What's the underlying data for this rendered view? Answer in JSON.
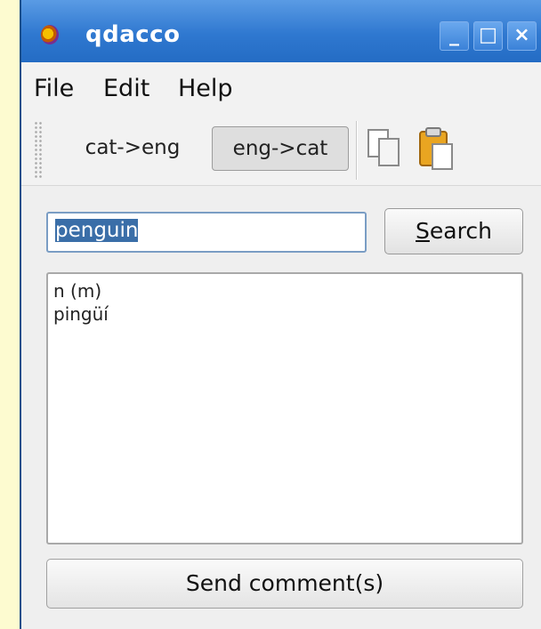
{
  "window": {
    "title": "qdacco",
    "controls": {
      "minimize": "_",
      "maximize": "□",
      "close": "×"
    }
  },
  "menu": {
    "items": [
      "File",
      "Edit",
      "Help"
    ]
  },
  "toolbar": {
    "direction_cat_eng": "cat->eng",
    "direction_eng_cat": "eng->cat",
    "active_direction": "eng->cat",
    "copy_icon": "copy-icon",
    "paste_icon": "paste-icon"
  },
  "search": {
    "value": "penguin",
    "button_label": "Search",
    "button_accel": "S",
    "button_rest": "earch"
  },
  "results": {
    "lines": [
      "n (m)",
      "pingüí"
    ]
  },
  "footer": {
    "send_label": "Send comment(s)"
  },
  "colors": {
    "titlebar": "#2f78d0",
    "selection": "#3a6ea8",
    "page_bg": "#fdfbd0"
  }
}
